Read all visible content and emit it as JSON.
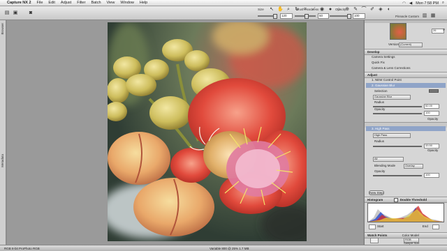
{
  "menubar": {
    "app": "Capture NX 2",
    "items": [
      "File",
      "Edit",
      "Adjust",
      "Filter",
      "Batch",
      "View",
      "Window",
      "Help"
    ],
    "clock": "Mon 7:58 PM"
  },
  "toolbar": {
    "size_label": "Size",
    "size_value": "120",
    "hardness_label": "Brush Hardness",
    "hardness_value": "50",
    "opacity_label": "Opacity",
    "opacity_value": "100",
    "preset_label": "Pinnacle Custom"
  },
  "left_tabs": {
    "top": "Browser",
    "bottom": "Metadata"
  },
  "panel": {
    "zoom": "26",
    "version_label": "Version",
    "version_value": "(Current)",
    "develop_header": "Develop",
    "develop_items": [
      "Camera Settings",
      "Quick Fix",
      "Camera & Lens Corrections"
    ],
    "adjust_header": "Adjust",
    "step1": "1. NEW Control Point",
    "step2": "2. Gaussian Blur",
    "selection_label": "Selection",
    "step2_select": "Gaussian Blur",
    "radius_label": "Radius",
    "radius_value": "52.00",
    "opacity_label": "Opacity",
    "opacity_value": "100",
    "opacity_toggle": "Opacity",
    "step3": "3. High Pass",
    "step3_select": "High Pass",
    "radius2_label": "Radius",
    "radius2_value": "33.50",
    "opacity2_toggle": "Opacity",
    "channel_select": "All",
    "blending_label": "Blending Mode",
    "blending_value": "Overlay",
    "opacity3_label": "Opacity",
    "opacity3_value": "100",
    "new_step": "New Step",
    "histogram_label": "Histogram",
    "double_threshold": "Double Threshold",
    "start_label": "Start",
    "end_label": "End",
    "watch_points": "Watch Points",
    "color_model_label": "Color Model",
    "color_model_value": "RGB",
    "sample_size_label": "Sample Size",
    "sample_size_value": "3x3 Average"
  },
  "status": {
    "left": "RGB 8-bit ProPhoto RGB",
    "center": "Variable 800 @ 25% 1.7 MB"
  },
  "colors": {
    "accent": "#8fa4c8",
    "canvas_bg": "#9a9a9a",
    "panel_bg": "#d6d6d6"
  }
}
